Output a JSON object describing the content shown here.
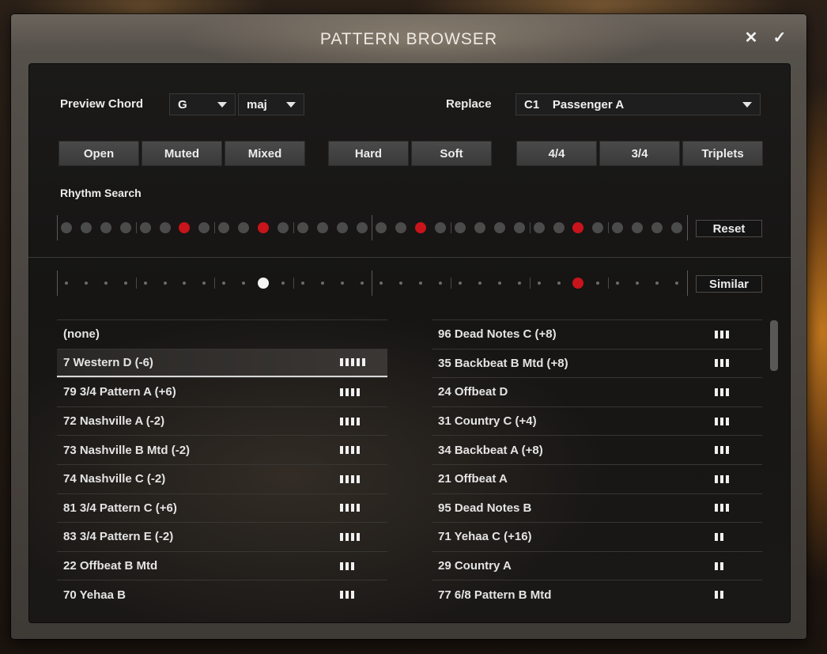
{
  "window": {
    "title": "PATTERN BROWSER",
    "close_glyph": "✕",
    "ok_glyph": "✓"
  },
  "preview": {
    "label": "Preview Chord",
    "root": "G",
    "quality": "maj"
  },
  "replace": {
    "label": "Replace",
    "value": "C1    Passenger A"
  },
  "articulation_buttons": [
    "Open",
    "Muted",
    "Mixed"
  ],
  "dynamics_buttons": [
    "Hard",
    "Soft"
  ],
  "meter_buttons": [
    "4/4",
    "3/4",
    "Triplets"
  ],
  "rhythm_search": {
    "label": "Rhythm Search",
    "reset_label": "Reset",
    "steps": 32,
    "active_steps": [
      6,
      10,
      18,
      26
    ]
  },
  "similar": {
    "label": "Similar",
    "steps": 32,
    "white_step": 10,
    "red_step": 26
  },
  "colors": {
    "active_red": "#c8141a",
    "white": "#f4f4f4",
    "dot_gray": "#4b4b4b"
  },
  "patterns_left": [
    {
      "name": "(none)",
      "bars": 0
    },
    {
      "name": "7 Western D (-6)",
      "bars": 5,
      "selected": true
    },
    {
      "name": "79 3/4 Pattern A (+6)",
      "bars": 4
    },
    {
      "name": "72 Nashville A (-2)",
      "bars": 4
    },
    {
      "name": "73 Nashville B Mtd (-2)",
      "bars": 4
    },
    {
      "name": "74 Nashville C (-2)",
      "bars": 4
    },
    {
      "name": "81 3/4 Pattern C (+6)",
      "bars": 4
    },
    {
      "name": "83 3/4 Pattern E (-2)",
      "bars": 4
    },
    {
      "name": "22 Offbeat B Mtd",
      "bars": 3
    },
    {
      "name": "70 Yehaa B",
      "bars": 3
    }
  ],
  "patterns_right": [
    {
      "name": "96 Dead Notes C (+8)",
      "bars": 3
    },
    {
      "name": "35 Backbeat B Mtd (+8)",
      "bars": 3
    },
    {
      "name": "24 Offbeat D",
      "bars": 3
    },
    {
      "name": "31 Country C (+4)",
      "bars": 3
    },
    {
      "name": "34 Backbeat A (+8)",
      "bars": 3
    },
    {
      "name": "21 Offbeat A",
      "bars": 3
    },
    {
      "name": "95 Dead Notes B",
      "bars": 3
    },
    {
      "name": "71 Yehaa C (+16)",
      "bars": 2
    },
    {
      "name": "29 Country A",
      "bars": 2
    },
    {
      "name": "77 6/8 Pattern B Mtd",
      "bars": 2
    }
  ]
}
